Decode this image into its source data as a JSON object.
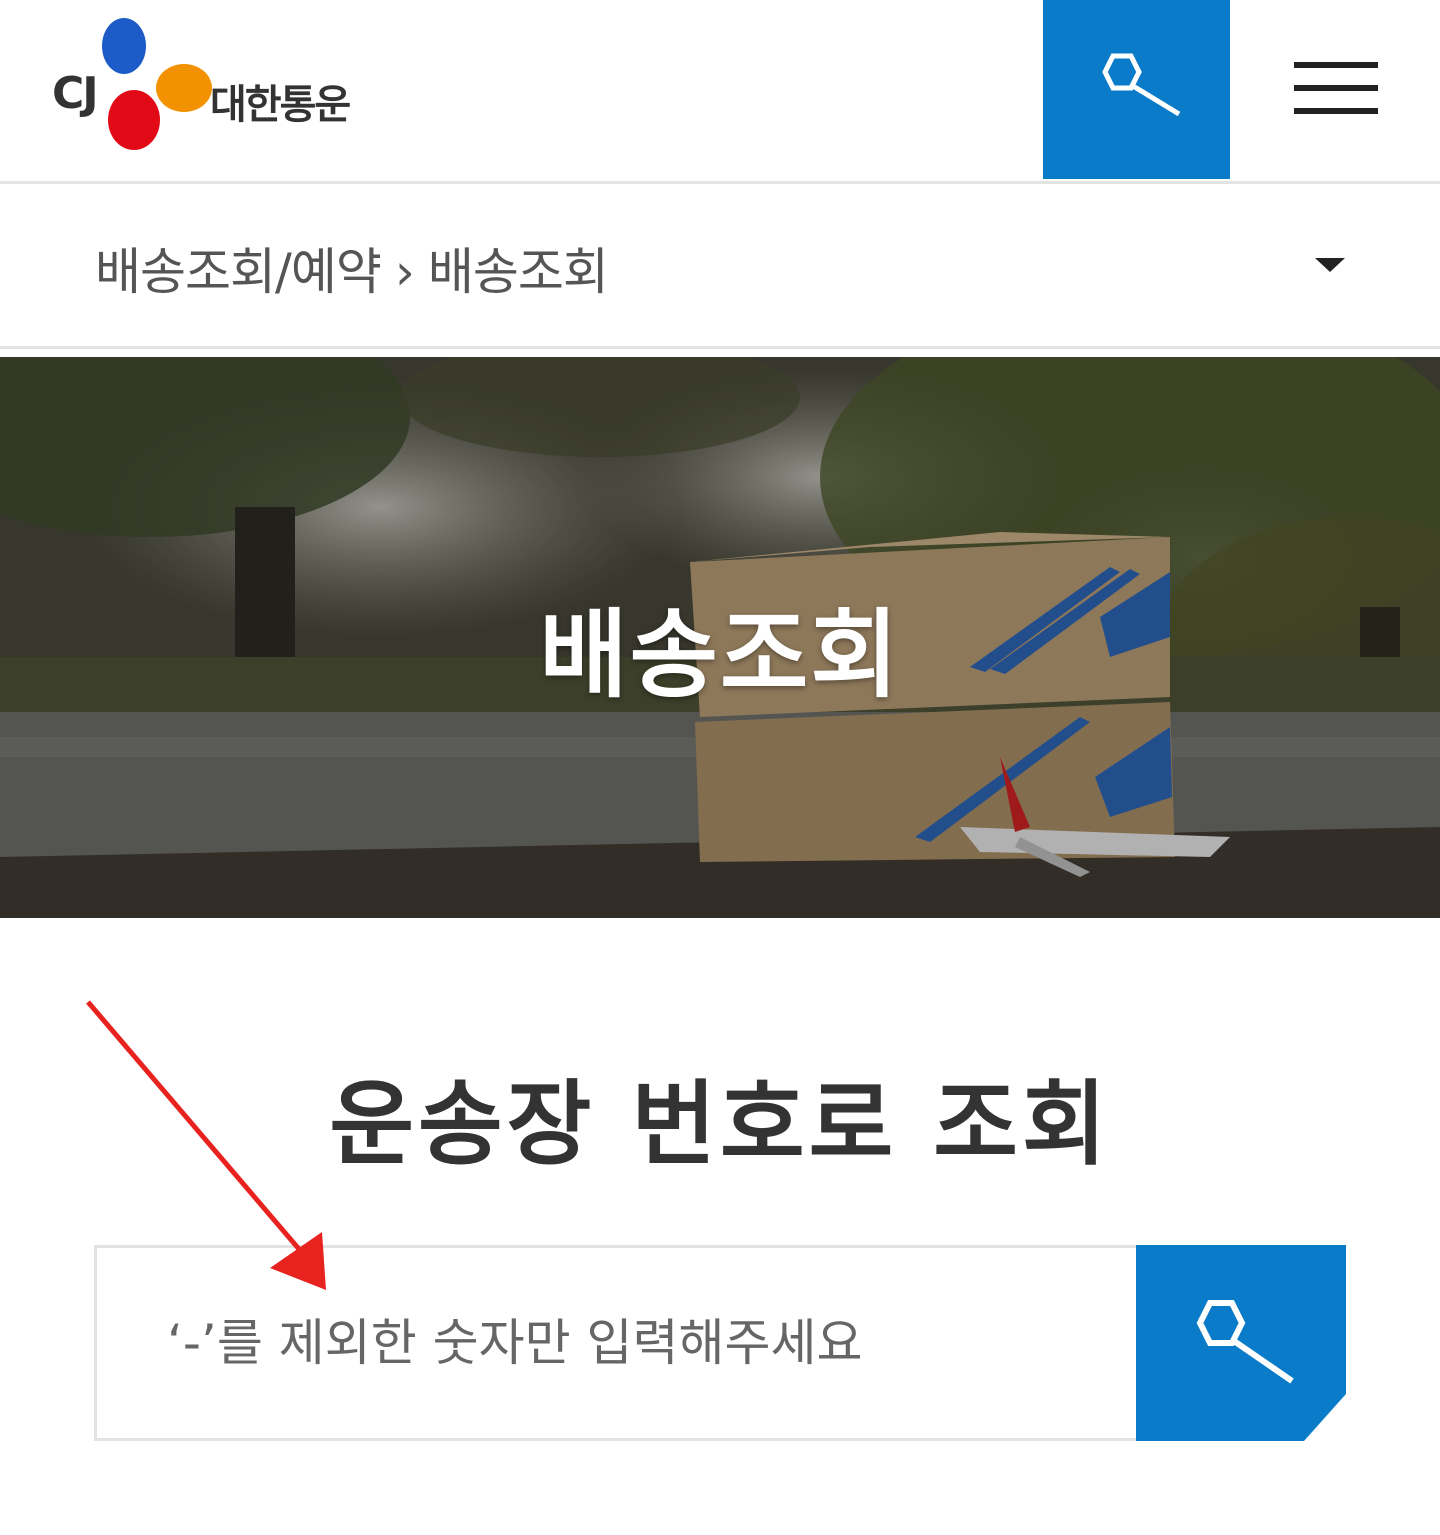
{
  "header": {
    "logo_cj": "CJ",
    "logo_name": "대한통운",
    "search_icon": "search-icon",
    "menu_icon": "hamburger-menu-icon",
    "accent_color": "#0a7bc8"
  },
  "breadcrumb": {
    "parent": "배송조회/예약",
    "separator": "›",
    "current": "배송조회",
    "dropdown_icon": "caret-down-icon"
  },
  "hero": {
    "title": "배송조회"
  },
  "tracking": {
    "title": "운송장 번호로 조회",
    "placeholder": "‘-’를 제외한 숫자만 입력해주세요",
    "submit_icon": "search-icon"
  },
  "annotation": {
    "arrow_color": "#e8231f"
  }
}
